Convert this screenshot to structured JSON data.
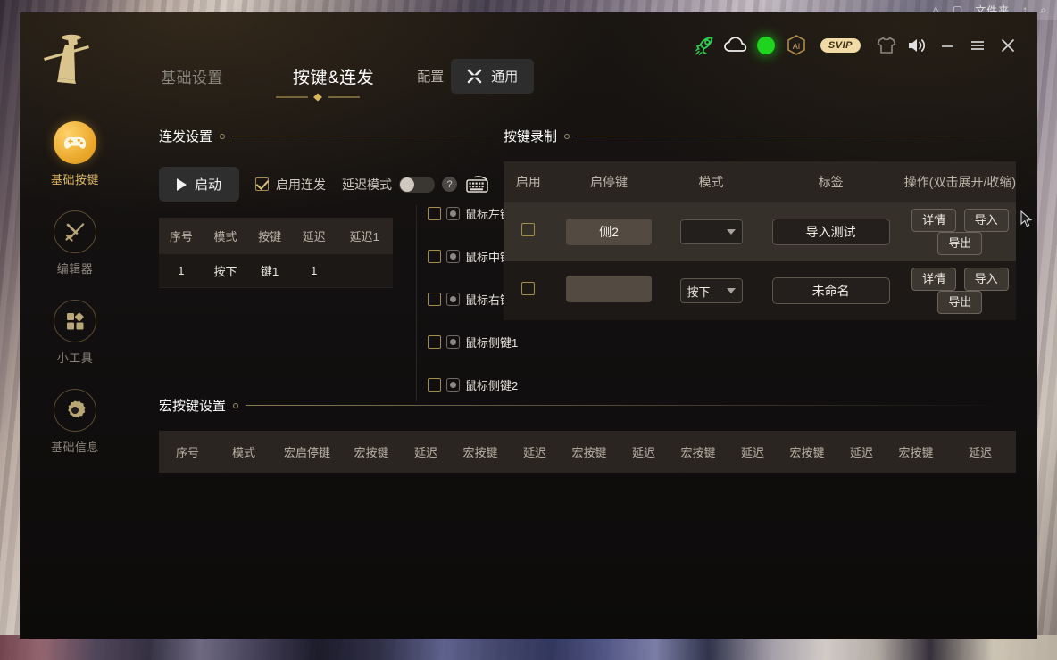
{
  "desktop": {
    "bg_window_label": "文件夹",
    "bg_window_icons": [
      "△",
      "▢",
      "↑",
      "⌕"
    ]
  },
  "titlebar": {
    "logo_name": "samurai-logo",
    "nav": [
      {
        "label": "基础设置",
        "active": false
      },
      {
        "label": "按键&连发",
        "active": true
      }
    ],
    "config_label": "配置",
    "general_button": "通用",
    "svip_badge": "SVIP",
    "icons": [
      "rocket-icon",
      "cloud-icon",
      "status-dot",
      "ai-icon",
      "shirt-icon",
      "volume-icon",
      "minimize-icon",
      "menu-icon",
      "close-icon"
    ],
    "minimize": "—",
    "menu": "☰",
    "close": "✕"
  },
  "sidebar": {
    "items": [
      {
        "label": "基础按键",
        "icon": "gamepad-icon",
        "active": true
      },
      {
        "label": "编辑器",
        "icon": "sword-icon",
        "active": false
      },
      {
        "label": "小工具",
        "icon": "tools-grid-icon",
        "active": false
      },
      {
        "label": "基础信息",
        "icon": "gear-icon",
        "active": false
      }
    ]
  },
  "burst": {
    "section_title": "连发设置",
    "start_button": "启动",
    "enable_checkbox_label": "启用连发",
    "enable_checked": true,
    "delay_mode_label": "延迟模式",
    "delay_mode_on": false,
    "help_glyph": "?",
    "keyboard_icon": "keyboard-icon",
    "columns": [
      "序号",
      "模式",
      "按键",
      "延迟",
      "延迟1"
    ],
    "rows": [
      [
        "1",
        "按下",
        "键1",
        "1",
        ""
      ]
    ],
    "mouse_buttons": [
      {
        "label": "鼠标左键",
        "checked": false
      },
      {
        "label": "鼠标中键",
        "checked": false
      },
      {
        "label": "鼠标右键",
        "checked": false
      },
      {
        "label": "鼠标侧键1",
        "checked": false
      },
      {
        "label": "鼠标侧键2",
        "checked": false
      }
    ]
  },
  "record": {
    "section_title": "按键录制",
    "columns": [
      "启用",
      "启停键",
      "模式",
      "标签",
      "操作(双击展开/收缩)"
    ],
    "rows": [
      {
        "enabled": false,
        "key": "侧2",
        "mode": "",
        "tag": "导入测试",
        "actions": [
          "详情",
          "导入",
          "导出"
        ],
        "highlight": true
      },
      {
        "enabled": false,
        "key": "",
        "mode": "按下",
        "tag": "未命名",
        "actions": [
          "详情",
          "导入",
          "导出"
        ],
        "highlight": false
      }
    ]
  },
  "macro": {
    "section_title": "宏按键设置",
    "columns": [
      "序号",
      "模式",
      "宏启停键",
      "宏按键",
      "延迟",
      "宏按键",
      "延迟",
      "宏按键",
      "延迟",
      "宏按键",
      "延迟",
      "宏按键",
      "延迟",
      "宏按键",
      "延迟"
    ]
  },
  "colors": {
    "accent_gold": "#e0b963",
    "panel": "#2a2521",
    "row_highlight": "#35302a",
    "status_green": "#1fd41f",
    "svip": "#f0dba6"
  }
}
